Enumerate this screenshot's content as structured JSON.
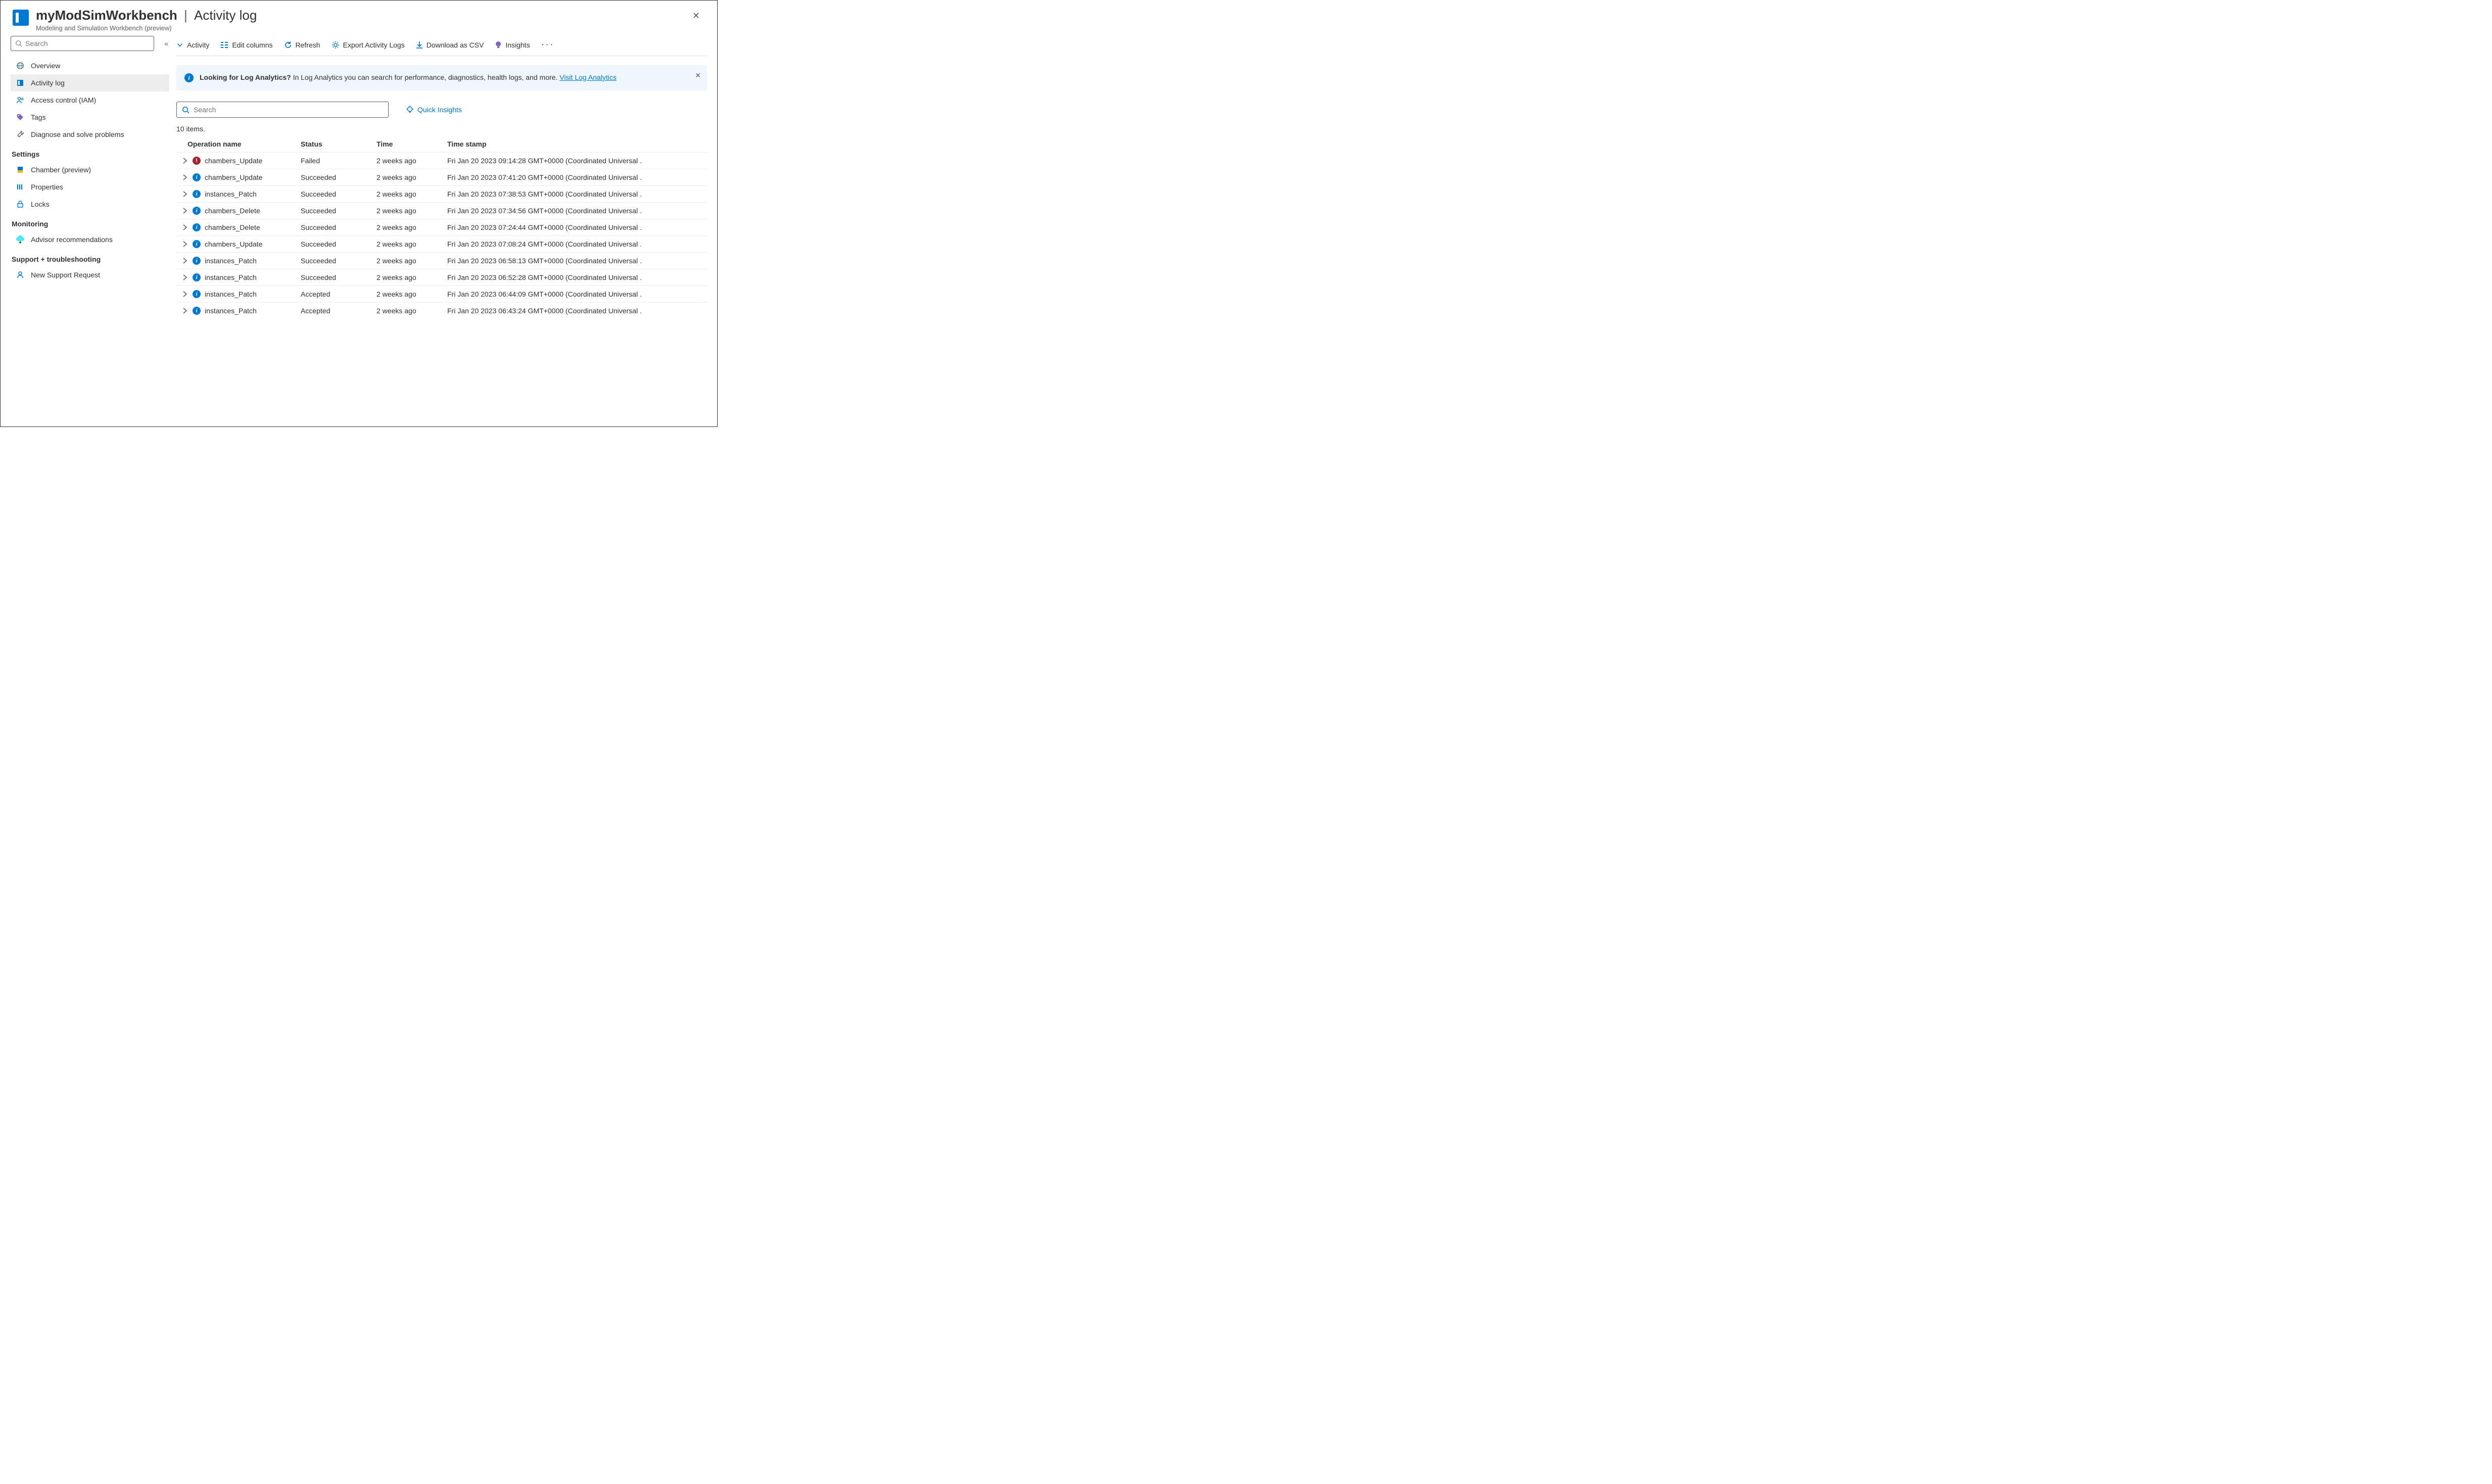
{
  "header": {
    "resource_name": "myModSimWorkbench",
    "section_title": "Activity log",
    "subtitle": "Modeling and Simulation Workbench (preview)"
  },
  "sidebar": {
    "search_placeholder": "Search",
    "groups": [
      {
        "label": null,
        "items": [
          {
            "key": "overview",
            "label": "Overview",
            "icon": "globe-icon",
            "active": false
          },
          {
            "key": "activity-log",
            "label": "Activity log",
            "icon": "log-icon",
            "active": true
          },
          {
            "key": "access-control",
            "label": "Access control (IAM)",
            "icon": "people-icon",
            "active": false
          },
          {
            "key": "tags",
            "label": "Tags",
            "icon": "tag-icon",
            "active": false
          },
          {
            "key": "diagnose",
            "label": "Diagnose and solve problems",
            "icon": "wrench-icon",
            "active": false
          }
        ]
      },
      {
        "label": "Settings",
        "items": [
          {
            "key": "chamber",
            "label": "Chamber (preview)",
            "icon": "chamber-icon",
            "active": false
          },
          {
            "key": "properties",
            "label": "Properties",
            "icon": "properties-icon",
            "active": false
          },
          {
            "key": "locks",
            "label": "Locks",
            "icon": "lock-icon",
            "active": false
          }
        ]
      },
      {
        "label": "Monitoring",
        "items": [
          {
            "key": "advisor",
            "label": "Advisor recommendations",
            "icon": "advisor-icon",
            "active": false
          }
        ]
      },
      {
        "label": "Support + troubleshooting",
        "items": [
          {
            "key": "support",
            "label": "New Support Request",
            "icon": "support-icon",
            "active": false
          }
        ]
      }
    ]
  },
  "toolbar": {
    "activity": "Activity",
    "edit_columns": "Edit columns",
    "refresh": "Refresh",
    "export": "Export Activity Logs",
    "download": "Download as CSV",
    "insights": "Insights"
  },
  "banner": {
    "title": "Looking for Log Analytics?",
    "body": "In Log Analytics you can search for performance, diagnostics, health logs, and more.",
    "link_text": "Visit Log Analytics"
  },
  "log_search_placeholder": "Search",
  "quick_insights_label": "Quick Insights",
  "item_count_text": "10 items.",
  "columns": {
    "operation": "Operation name",
    "status": "Status",
    "time": "Time",
    "timestamp": "Time stamp"
  },
  "rows": [
    {
      "icon": "error",
      "operation": "chambers_Update",
      "status": "Failed",
      "time": "2 weeks ago",
      "timestamp": "Fri Jan 20 2023 09:14:28 GMT+0000 (Coordinated Universal ."
    },
    {
      "icon": "info",
      "operation": "chambers_Update",
      "status": "Succeeded",
      "time": "2 weeks ago",
      "timestamp": "Fri Jan 20 2023 07:41:20 GMT+0000 (Coordinated Universal ."
    },
    {
      "icon": "info",
      "operation": "instances_Patch",
      "status": "Succeeded",
      "time": "2 weeks ago",
      "timestamp": "Fri Jan 20 2023 07:38:53 GMT+0000 (Coordinated Universal ."
    },
    {
      "icon": "info",
      "operation": "chambers_Delete",
      "status": "Succeeded",
      "time": "2 weeks ago",
      "timestamp": "Fri Jan 20 2023 07:34:56 GMT+0000 (Coordinated Universal ."
    },
    {
      "icon": "info",
      "operation": "chambers_Delete",
      "status": "Succeeded",
      "time": "2 weeks ago",
      "timestamp": "Fri Jan 20 2023 07:24:44 GMT+0000 (Coordinated Universal ."
    },
    {
      "icon": "info",
      "operation": "chambers_Update",
      "status": "Succeeded",
      "time": "2 weeks ago",
      "timestamp": "Fri Jan 20 2023 07:08:24 GMT+0000 (Coordinated Universal ."
    },
    {
      "icon": "info",
      "operation": "instances_Patch",
      "status": "Succeeded",
      "time": "2 weeks ago",
      "timestamp": "Fri Jan 20 2023 06:58:13 GMT+0000 (Coordinated Universal ."
    },
    {
      "icon": "info",
      "operation": "instances_Patch",
      "status": "Succeeded",
      "time": "2 weeks ago",
      "timestamp": "Fri Jan 20 2023 06:52:28 GMT+0000 (Coordinated Universal ."
    },
    {
      "icon": "info",
      "operation": "instances_Patch",
      "status": "Accepted",
      "time": "2 weeks ago",
      "timestamp": "Fri Jan 20 2023 06:44:09 GMT+0000 (Coordinated Universal ."
    },
    {
      "icon": "info",
      "operation": "instances_Patch",
      "status": "Accepted",
      "time": "2 weeks ago",
      "timestamp": "Fri Jan 20 2023 06:43:24 GMT+0000 (Coordinated Universal ."
    }
  ]
}
